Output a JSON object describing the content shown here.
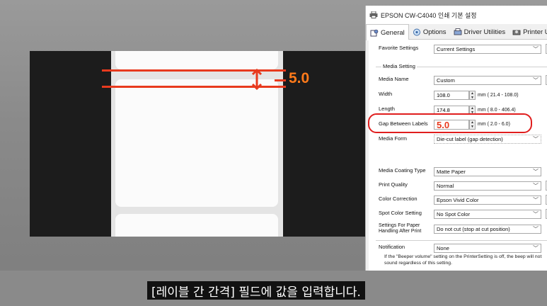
{
  "video": {
    "overlay_gap_value": "5.0",
    "subtitle": "[레이블 간 간격] 필드에 값을 입력합니다."
  },
  "dialog": {
    "title": "EPSON CW-C4040 인쇄 기본 설정",
    "tabs": [
      {
        "label": "General",
        "icon": "page-settings-icon"
      },
      {
        "label": "Options",
        "icon": "options-icon"
      },
      {
        "label": "Driver Utilities",
        "icon": "driver-utilities-icon"
      },
      {
        "label": "Printer Utilities",
        "icon": "printer-utilities-icon"
      }
    ],
    "favorite_settings": {
      "label": "Favorite Settings",
      "value": "Current Settings"
    },
    "media_setting_title": "Media Setting",
    "media_name": {
      "label": "Media Name",
      "value": "Custom"
    },
    "width": {
      "label": "Width",
      "value": "108.0",
      "range": "mm ( 21.4 - 108.0)"
    },
    "length": {
      "label": "Length",
      "value": "174.8",
      "range": "mm ( 8.0 - 406.4)"
    },
    "gap": {
      "label": "Gap Between Labels",
      "value": "5.0",
      "range": "mm ( 2.0 -  6.0)"
    },
    "media_form": {
      "label": "Media Form",
      "value": "Die-cut label (gap detection)"
    },
    "media_coating": {
      "label": "Media Coating Type",
      "value": "Matte Paper"
    },
    "print_quality": {
      "label": "Print Quality",
      "value": "Normal"
    },
    "color_correction": {
      "label": "Color Correction",
      "value": "Epson Vivid Color"
    },
    "spot_color": {
      "label": "Spot Color Setting",
      "value": "No Spot Color"
    },
    "after_print": {
      "label": "Settings For Paper Handling After Print",
      "value": "Do not cut (stop at cut position)"
    },
    "notification": {
      "label": "Notification",
      "value": "None"
    },
    "note": "If the \"Beeper volume\" setting on the PrinterSetting is off, the beep will not sound regardless of this setting."
  },
  "colors": {
    "highlight_red": "#e01e1e",
    "overlay_orange": "#ff7a1a"
  }
}
